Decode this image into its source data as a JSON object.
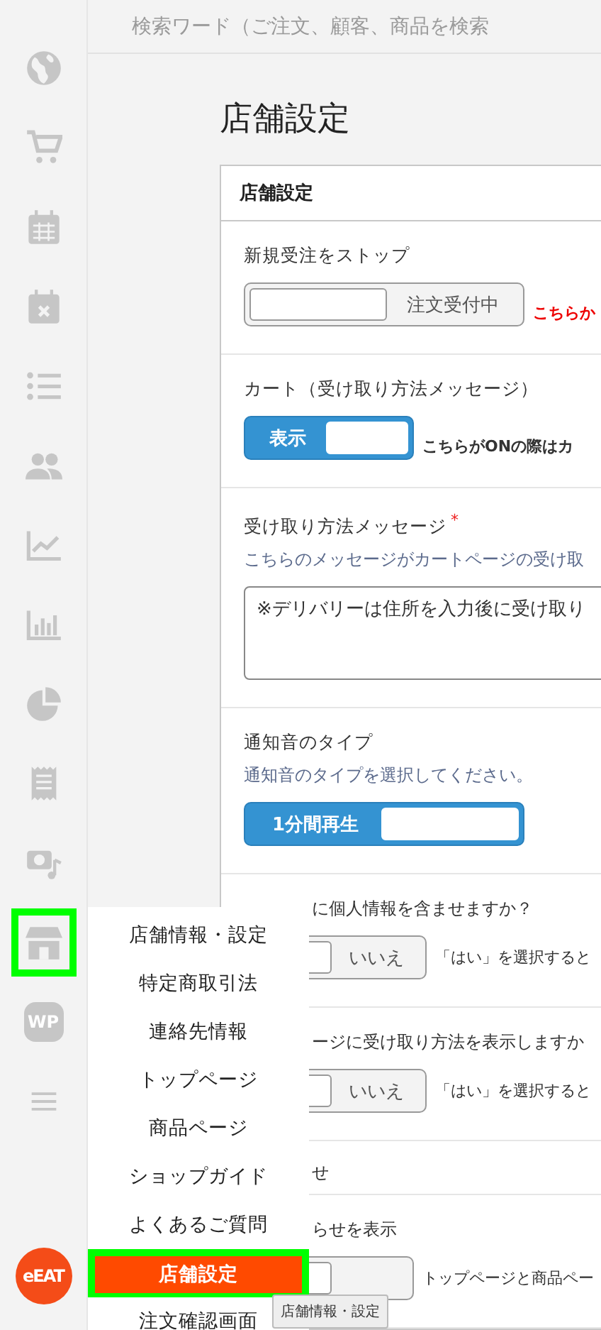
{
  "sidebar": {
    "items": [
      {
        "kind": "icon",
        "highlighted": false
      },
      {
        "kind": "icon",
        "highlighted": false
      },
      {
        "kind": "icon",
        "highlighted": false
      },
      {
        "kind": "icon",
        "highlighted": false
      },
      {
        "kind": "icon",
        "highlighted": false
      },
      {
        "kind": "icon",
        "highlighted": false
      },
      {
        "kind": "icon",
        "highlighted": false
      },
      {
        "kind": "icon",
        "highlighted": false
      },
      {
        "kind": "icon",
        "highlighted": false
      },
      {
        "kind": "icon",
        "highlighted": false
      },
      {
        "kind": "icon",
        "highlighted": false
      },
      {
        "kind": "icon",
        "highlighted": true
      },
      {
        "kind": "badge",
        "label": "WP",
        "highlighted": false
      },
      {
        "kind": "icon",
        "highlighted": false
      }
    ],
    "logo": {
      "label": "eEAT"
    }
  },
  "search": {
    "placeholder": "検索ワード（ご注文、顧客、商品を検索"
  },
  "page_title": "店舗設定",
  "card": {
    "title": "店舗設定",
    "rows": [
      {
        "kind": "toggle",
        "label": "新規受注をストップ",
        "toggle": {
          "label": "注文受付中",
          "on": false
        },
        "note": {
          "text": "こちらか",
          "kind": "alert"
        }
      },
      {
        "kind": "toggle",
        "label": "カート（受け取り方法メッセージ）",
        "toggle": {
          "label": "表示",
          "on": true
        },
        "note": {
          "text": "こちらがONの際はカ",
          "kind": "bold"
        }
      },
      {
        "kind": "textarea",
        "label": "受け取り方法メッセージ",
        "required_mark": "*",
        "description": "こちらのメッセージがカートページの受け取",
        "value": "※デリバリーは住所を入力後に受け取り"
      },
      {
        "kind": "toggle",
        "label": "通知音のタイプ",
        "description": "通知音のタイプを選択してください。",
        "toggle": {
          "label": "1分間再生",
          "on": true
        }
      },
      {
        "kind": "toggle",
        "label": "に個人情報を含ませますか？",
        "covered": true,
        "toggle": {
          "label": "いいえ",
          "on": false
        },
        "note": {
          "text": "「はい」を選択すると",
          "kind": "plain"
        }
      },
      {
        "kind": "toggle",
        "label": "ージに受け取り方法を表示しますか",
        "covered": true,
        "toggle": {
          "label": "いいえ",
          "on": false
        },
        "note": {
          "text": "「はい」を選択すると",
          "kind": "plain"
        }
      },
      {
        "kind": "heading",
        "label": "せ",
        "covered": true
      },
      {
        "kind": "toggle",
        "label": "らせを表示",
        "covered": true,
        "toggle": {
          "on": false
        },
        "note": {
          "text": "トップページと商品ペー",
          "kind": "plain"
        }
      }
    ]
  },
  "flyout_menu": {
    "items": [
      {
        "label": "店舗情報・設定",
        "selected": false
      },
      {
        "label": "特定商取引法",
        "selected": false
      },
      {
        "label": "連絡先情報",
        "selected": false
      },
      {
        "label": "トップページ",
        "selected": false
      },
      {
        "label": "商品ページ",
        "selected": false
      },
      {
        "label": "ショップガイド",
        "selected": false
      },
      {
        "label": "よくあるご質問",
        "selected": false
      },
      {
        "label": "店舗設定",
        "selected": true
      },
      {
        "label": "注文確認画面",
        "selected": false
      }
    ]
  },
  "tooltip": "店舗情報・設定"
}
